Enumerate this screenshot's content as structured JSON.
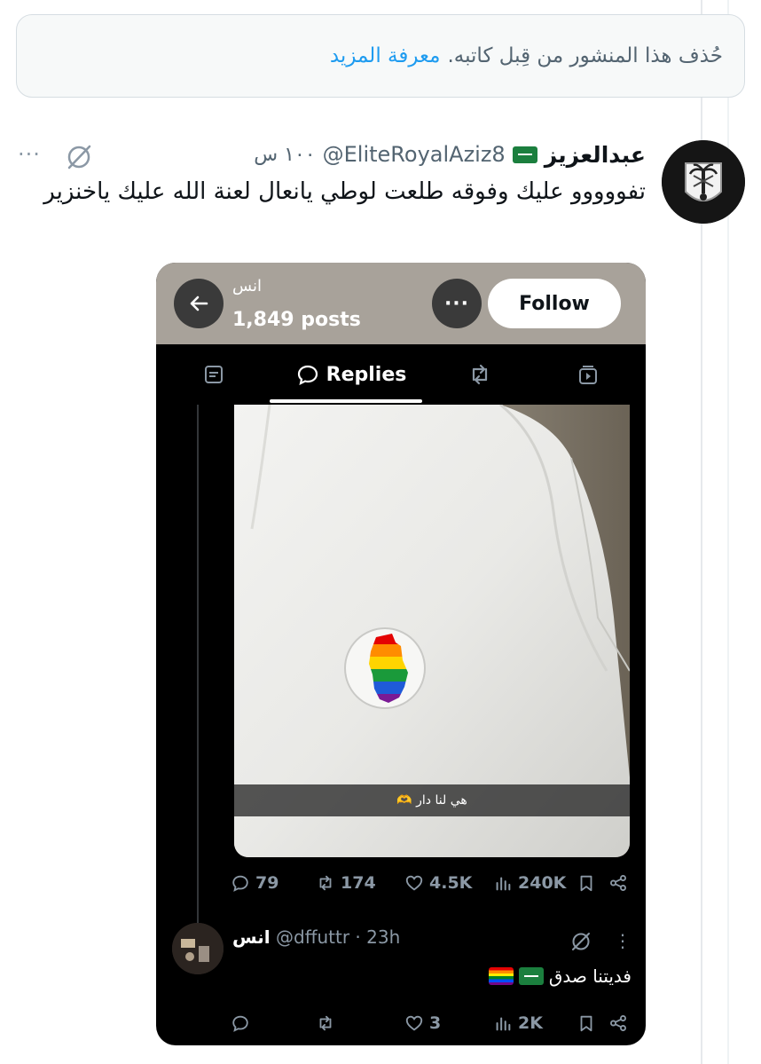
{
  "deleted_notice": {
    "text": "حُذف هذا المنشور من قِبل كاتبه.",
    "learn_more": "معرفة المزيد"
  },
  "tweet": {
    "display_name": "عبدالعزيز",
    "handle": "@EliteRoyalAziz8",
    "time": "١٠٠ س",
    "text": "تفووووو عليك وفوقه طلعت لوطي يانعال لعنة الله عليك ياخنزير",
    "more": "···"
  },
  "embed": {
    "profile_name": "انس",
    "posts_count": "1,849 posts",
    "follow_label": "Follow",
    "more_label": "···",
    "tabs": [
      {
        "name": "posts",
        "label": ""
      },
      {
        "name": "replies",
        "label": "Replies"
      },
      {
        "name": "reposts",
        "label": ""
      },
      {
        "name": "media",
        "label": ""
      }
    ],
    "photo_caption": "هي لنا دار 🫶",
    "stats": {
      "replies": "79",
      "reposts": "174",
      "likes": "4.5K",
      "views": "240K"
    },
    "reply": {
      "name": "انس",
      "handle": "@dffuttr",
      "time": "· 23h",
      "text": "فديتنا صدق",
      "more": "⋮",
      "stats": {
        "replies": "",
        "reposts": "",
        "likes": "3",
        "views": "2K"
      }
    }
  },
  "colors": {
    "link": "#1d9bf0",
    "muted": "#536471",
    "dark_muted": "#8b98a5"
  }
}
